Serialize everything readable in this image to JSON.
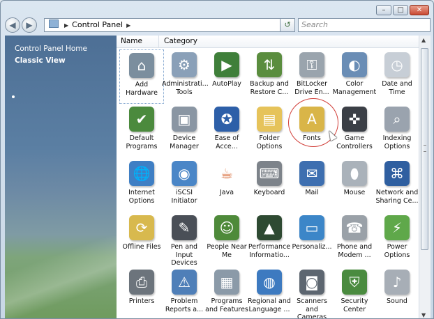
{
  "window": {
    "caption_buttons": [
      {
        "name": "minimize-button",
        "glyph": "–"
      },
      {
        "name": "maximize-button",
        "glyph": "□"
      },
      {
        "name": "close-button",
        "glyph": "✕"
      }
    ]
  },
  "nav": {
    "back_glyph": "◀",
    "forward_glyph": "▶",
    "address": "Control Panel",
    "refresh_glyph": "↺",
    "search_placeholder": "Search"
  },
  "left_pane": {
    "home": "Control Panel Home",
    "classic_view": "Classic View"
  },
  "columns": {
    "name": "Name",
    "category": "Category"
  },
  "items": [
    {
      "label": "Add\nHardware",
      "icon": "add-hardware-icon",
      "color": "#7b8e9e",
      "glyph": "⌂"
    },
    {
      "label": "Administrati...\nTools",
      "icon": "administrative-tools-icon",
      "color": "#8aa0b8",
      "glyph": "⚙"
    },
    {
      "label": "AutoPlay",
      "icon": "autoplay-icon",
      "color": "#3f7f3a",
      "glyph": "▶"
    },
    {
      "label": "Backup and\nRestore C...",
      "icon": "backup-restore-icon",
      "color": "#5a8d3e",
      "glyph": "⇅"
    },
    {
      "label": "BitLocker\nDrive En...",
      "icon": "bitlocker-icon",
      "color": "#9aa4ad",
      "glyph": "⚿"
    },
    {
      "label": "Color\nManagement",
      "icon": "color-management-icon",
      "color": "#6a8db5",
      "glyph": "◐"
    },
    {
      "label": "Date and\nTime",
      "icon": "date-time-icon",
      "color": "#c7ced6",
      "glyph": "◷"
    },
    {
      "label": "Default\nPrograms",
      "icon": "default-programs-icon",
      "color": "#4b8a3d",
      "glyph": "✔"
    },
    {
      "label": "Device\nManager",
      "icon": "device-manager-icon",
      "color": "#8a96a3",
      "glyph": "▣"
    },
    {
      "label": "Ease of\nAcce...",
      "icon": "ease-of-access-icon",
      "color": "#2d5fa8",
      "glyph": "✪"
    },
    {
      "label": "Folder\nOptions",
      "icon": "folder-options-icon",
      "color": "#e6c35a",
      "glyph": "▤"
    },
    {
      "label": "Fonts",
      "icon": "fonts-icon",
      "color": "#d9b548",
      "glyph": "A"
    },
    {
      "label": "Game\nControllers",
      "icon": "game-controllers-icon",
      "color": "#3b3f46",
      "glyph": "✜"
    },
    {
      "label": "Indexing\nOptions",
      "icon": "indexing-options-icon",
      "color": "#9aa3ae",
      "glyph": "⌕"
    },
    {
      "label": "Internet\nOptions",
      "icon": "internet-options-icon",
      "color": "#3f7fc4",
      "glyph": "🌐"
    },
    {
      "label": "iSCSI Initiator",
      "icon": "iscsi-initiator-icon",
      "color": "#4a86c7",
      "glyph": "◉"
    },
    {
      "label": "Java",
      "icon": "java-icon",
      "color": "#ffffff",
      "glyph": "☕"
    },
    {
      "label": "Keyboard",
      "icon": "keyboard-icon",
      "color": "#7d838a",
      "glyph": "⌨"
    },
    {
      "label": "Mail",
      "icon": "mail-icon",
      "color": "#3e6fb0",
      "glyph": "✉"
    },
    {
      "label": "Mouse",
      "icon": "mouse-icon",
      "color": "#aab2ba",
      "glyph": "⬮"
    },
    {
      "label": "Network and\nSharing Ce...",
      "icon": "network-sharing-icon",
      "color": "#2f5fa0",
      "glyph": "⌘"
    },
    {
      "label": "Offline Files",
      "icon": "offline-files-icon",
      "color": "#d8b94e",
      "glyph": "⟳"
    },
    {
      "label": "Pen and\nInput Devices",
      "icon": "pen-input-icon",
      "color": "#4a4f57",
      "glyph": "✎"
    },
    {
      "label": "People Near\nMe",
      "icon": "people-near-me-icon",
      "color": "#4e8a3a",
      "glyph": "☺"
    },
    {
      "label": "Performance\nInformatio...",
      "icon": "performance-information-icon",
      "color": "#2e4a32",
      "glyph": "▲"
    },
    {
      "label": "Personaliz...",
      "icon": "personalization-icon",
      "color": "#3c86c8",
      "glyph": "▭"
    },
    {
      "label": "Phone and\nModem ...",
      "icon": "phone-modem-icon",
      "color": "#9aa1a8",
      "glyph": "☎"
    },
    {
      "label": "Power\nOptions",
      "icon": "power-options-icon",
      "color": "#5fa84a",
      "glyph": "⚡"
    },
    {
      "label": "Printers",
      "icon": "printers-icon",
      "color": "#6c747c",
      "glyph": "⎙"
    },
    {
      "label": "Problem\nReports a...",
      "icon": "problem-reports-icon",
      "color": "#4f7fb8",
      "glyph": "⚠"
    },
    {
      "label": "Programs\nand Features",
      "icon": "programs-features-icon",
      "color": "#8b9aa8",
      "glyph": "▦"
    },
    {
      "label": "Regional and\nLanguage ...",
      "icon": "regional-language-icon",
      "color": "#3d7ac0",
      "glyph": "◍"
    },
    {
      "label": "Scanners and\nCameras",
      "icon": "scanners-cameras-icon",
      "color": "#5d6670",
      "glyph": "◙"
    },
    {
      "label": "Security\nCenter",
      "icon": "security-center-icon",
      "color": "#4a8b3f",
      "glyph": "⛨"
    },
    {
      "label": "Sound",
      "icon": "sound-icon",
      "color": "#a7aeb6",
      "glyph": "♪"
    }
  ]
}
